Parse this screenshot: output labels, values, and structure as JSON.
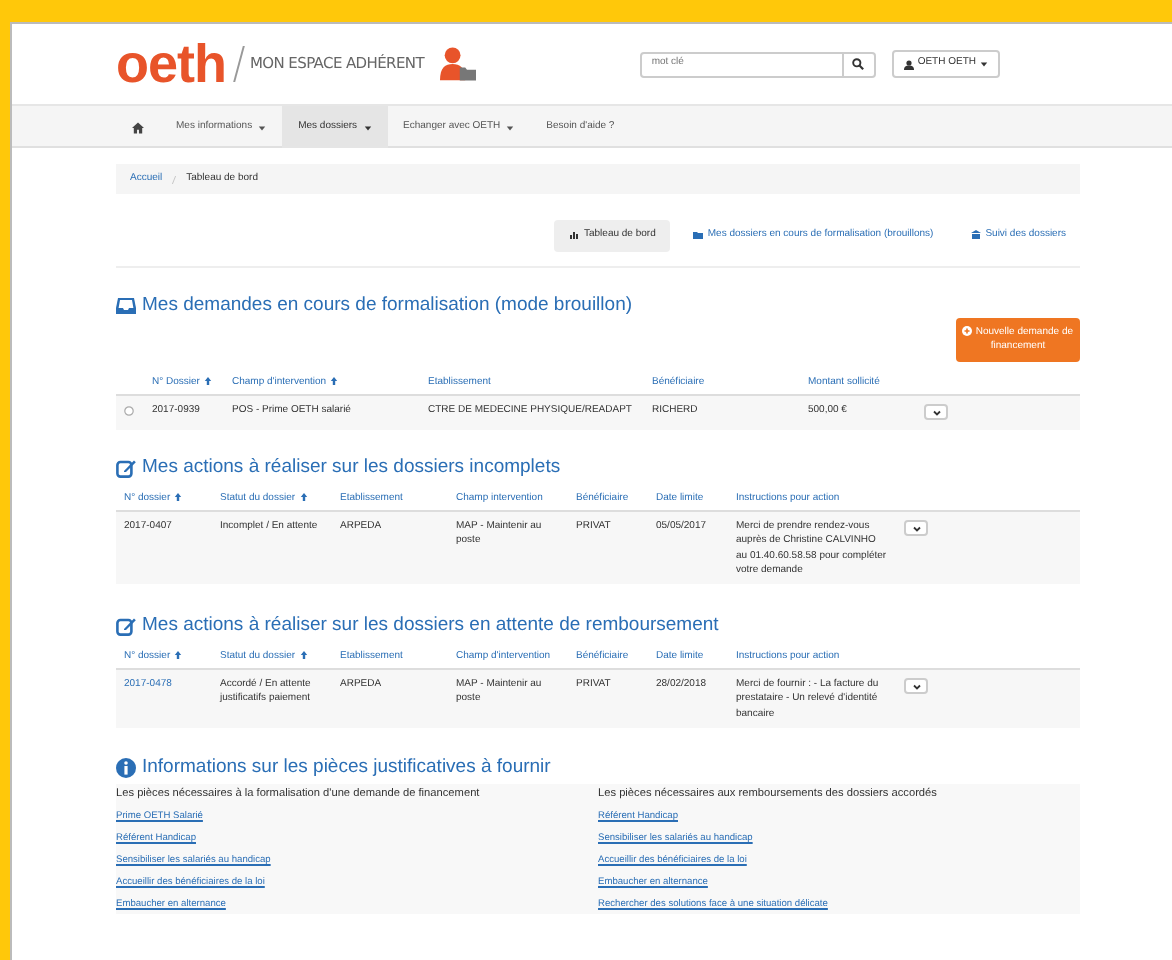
{
  "header": {
    "logo": "oeth",
    "subtitle": "MON ESPACE ADHÉRENT",
    "search": {
      "placeholder": "mot clé"
    },
    "user_menu": "OETH OETH"
  },
  "nav": [
    {
      "label": "Mes informations",
      "dropdown": true,
      "selected": false
    },
    {
      "label": "Mes dossiers",
      "dropdown": true,
      "selected": true
    },
    {
      "label": "Echanger avec OETH",
      "dropdown": true,
      "selected": false
    },
    {
      "label": "Besoin d'aide ?",
      "dropdown": false,
      "selected": false
    }
  ],
  "breadcrumb": [
    "Accueil",
    "Tableau de bord"
  ],
  "view_tabs": [
    {
      "label": "Tableau de bord",
      "selected": true
    },
    {
      "label": "Mes dossiers en cours de formalisation (brouillons)",
      "selected": false
    },
    {
      "label": "Suivi des dossiers",
      "selected": false
    }
  ],
  "drafts": {
    "title": "Mes demandes en cours de formalisation (mode brouillon)",
    "new_button": "Nouvelle demande de financement",
    "columns": [
      {
        "label": "N° Dossier",
        "sortable": true
      },
      {
        "label": "Champ d'intervention",
        "sortable": true
      },
      {
        "label": "Etablissement",
        "sortable": false
      },
      {
        "label": "Bénéficiaire",
        "sortable": false
      },
      {
        "label": "Montant sollicité",
        "sortable": false
      }
    ],
    "rows": [
      {
        "cells": [
          "2017-0939",
          "POS - Prime OETH salarié",
          "CTRE DE MEDECINE PHYSIQUE/READAPT",
          "RICHERD",
          "500,00 €"
        ]
      }
    ]
  },
  "incomplete": {
    "title": "Mes actions à réaliser sur les dossiers incomplets",
    "columns": [
      {
        "label": "N° dossier",
        "sortable": true
      },
      {
        "label": "Statut du dossier",
        "sortable": true
      },
      {
        "label": "Etablissement",
        "sortable": false
      },
      {
        "label": "Champ intervention",
        "sortable": false
      },
      {
        "label": "Bénéficiaire",
        "sortable": false
      },
      {
        "label": "Date limite",
        "sortable": false
      },
      {
        "label": "Instructions pour action",
        "sortable": false
      }
    ],
    "rows": [
      {
        "number_link": false,
        "cells": [
          "2017-0407",
          "Incomplet / En attente",
          "ARPEDA",
          "MAP - Maintenir au poste",
          "PRIVAT",
          "05/05/2017",
          "Merci de prendre rendez-vous auprès de Christine CALVINHO au 01.40.60.58.58 pour compléter votre demande"
        ]
      }
    ]
  },
  "reimbursement": {
    "title": "Mes actions à réaliser sur les dossiers en attente de remboursement",
    "columns": [
      {
        "label": "N° dossier",
        "sortable": true
      },
      {
        "label": "Statut du dossier",
        "sortable": true
      },
      {
        "label": "Etablissement",
        "sortable": false
      },
      {
        "label": "Champ d'intervention",
        "sortable": false
      },
      {
        "label": "Bénéficiaire",
        "sortable": false
      },
      {
        "label": "Date limite",
        "sortable": false
      },
      {
        "label": "Instructions pour action",
        "sortable": false
      }
    ],
    "rows": [
      {
        "number_link": true,
        "cells": [
          "2017-0478",
          "Accordé / En attente justificatifs paiement",
          "ARPEDA",
          "MAP - Maintenir au poste",
          "PRIVAT",
          "28/02/2018",
          "Merci de fournir : - La facture du prestataire - Un relevé d'identité bancaire"
        ]
      }
    ]
  },
  "info": {
    "title": "Informations sur les pièces justificatives à fournir",
    "columns": [
      {
        "heading": "Les pièces nécessaires à la formalisation d'une demande de financement",
        "links": [
          "Prime OETH Salarié",
          "Référent Handicap",
          "Sensibiliser les salariés au handicap",
          "Accueillir des bénéficiaires de la loi",
          "Embaucher en alternance"
        ]
      },
      {
        "heading": "Les pièces nécessaires aux remboursements des dossiers accordés",
        "links": [
          "Référent Handicap",
          "Sensibiliser les salariés au handicap",
          "Accueillir des bénéficiaires de la loi",
          "Embaucher en alternance",
          "Rechercher des solutions face à une situation délicate"
        ]
      }
    ]
  }
}
